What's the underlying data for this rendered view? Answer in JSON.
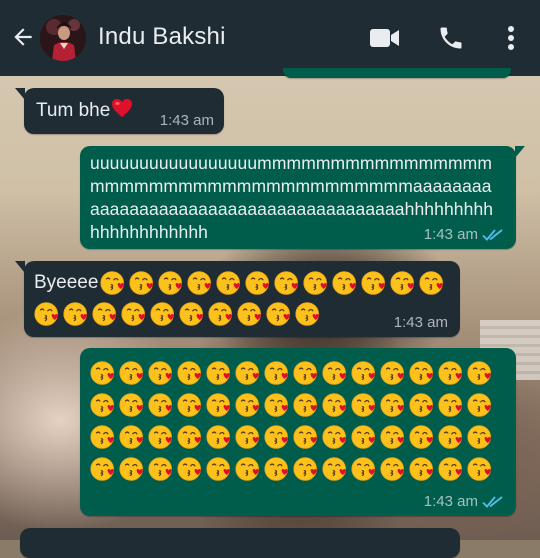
{
  "header": {
    "contact_name": "Indu Bakshi"
  },
  "icons": {
    "back": "arrow-left-icon",
    "video": "video-camera-icon",
    "call": "phone-icon",
    "menu": "more-vert-icon",
    "emoji": "face-blowing-kiss-emoji",
    "heart": "red-heart-emoji"
  },
  "colors": {
    "header_bg": "#1f2c34",
    "incoming_bubble": "#1f2c34",
    "outgoing_bubble": "#005c4b",
    "read_ticks": "#53bdeb",
    "heart": "#e0102a"
  },
  "messages": [
    {
      "direction": "incoming",
      "text": "Tum bhe",
      "trailing_emoji": "❤️",
      "time": "1:43 am"
    },
    {
      "direction": "outgoing",
      "text": "uuuuuuuuuuuuuuuuummmmmmmmmmmmmmmmmmmmmmmmmmmmmmmmmmmmmmaaaaaaaaaaaaaaaaaaaaaaaaaaaaaaaaaaaaaaaahhhhhhhhhhhhhhhhhhhhh",
      "time": "1:43 am",
      "status": "read"
    },
    {
      "direction": "incoming",
      "text": "Byeeee",
      "emoji_count": 22,
      "time": "1:43 am"
    },
    {
      "direction": "outgoing",
      "emoji_count": 56,
      "time": "1:43 am",
      "status": "read"
    }
  ]
}
